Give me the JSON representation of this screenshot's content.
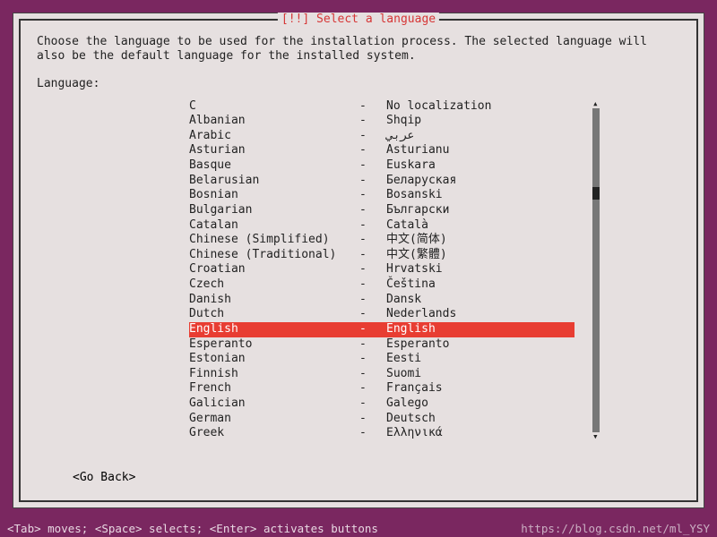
{
  "dialog": {
    "title": "[!!] Select a language",
    "instruction": "Choose the language to be used for the installation process. The selected language will also be the default language for the installed system.",
    "label": "Language:",
    "go_back": "<Go Back>"
  },
  "languages": [
    {
      "name": "C",
      "sep": "-",
      "native": "No localization",
      "selected": false
    },
    {
      "name": "Albanian",
      "sep": "-",
      "native": "Shqip",
      "selected": false
    },
    {
      "name": "Arabic",
      "sep": "-",
      "native": "عربي",
      "selected": false
    },
    {
      "name": "Asturian",
      "sep": "-",
      "native": "Asturianu",
      "selected": false
    },
    {
      "name": "Basque",
      "sep": "-",
      "native": "Euskara",
      "selected": false
    },
    {
      "name": "Belarusian",
      "sep": "-",
      "native": "Беларуская",
      "selected": false
    },
    {
      "name": "Bosnian",
      "sep": "-",
      "native": "Bosanski",
      "selected": false
    },
    {
      "name": "Bulgarian",
      "sep": "-",
      "native": "Български",
      "selected": false
    },
    {
      "name": "Catalan",
      "sep": "-",
      "native": "Català",
      "selected": false
    },
    {
      "name": "Chinese (Simplified)",
      "sep": "-",
      "native": "中文(简体)",
      "selected": false
    },
    {
      "name": "Chinese (Traditional)",
      "sep": "-",
      "native": "中文(繁體)",
      "selected": false
    },
    {
      "name": "Croatian",
      "sep": "-",
      "native": "Hrvatski",
      "selected": false
    },
    {
      "name": "Czech",
      "sep": "-",
      "native": "Čeština",
      "selected": false
    },
    {
      "name": "Danish",
      "sep": "-",
      "native": "Dansk",
      "selected": false
    },
    {
      "name": "Dutch",
      "sep": "-",
      "native": "Nederlands",
      "selected": false
    },
    {
      "name": "English",
      "sep": "-",
      "native": "English",
      "selected": true
    },
    {
      "name": "Esperanto",
      "sep": "-",
      "native": "Esperanto",
      "selected": false
    },
    {
      "name": "Estonian",
      "sep": "-",
      "native": "Eesti",
      "selected": false
    },
    {
      "name": "Finnish",
      "sep": "-",
      "native": "Suomi",
      "selected": false
    },
    {
      "name": "French",
      "sep": "-",
      "native": "Français",
      "selected": false
    },
    {
      "name": "Galician",
      "sep": "-",
      "native": "Galego",
      "selected": false
    },
    {
      "name": "German",
      "sep": "-",
      "native": "Deutsch",
      "selected": false
    },
    {
      "name": "Greek",
      "sep": "-",
      "native": "Ελληνικά",
      "selected": false
    }
  ],
  "footer": {
    "help": "<Tab> moves; <Space> selects; <Enter> activates buttons",
    "watermark": "https://blog.csdn.net/ml_YSY"
  },
  "colors": {
    "bg": "#7a2760",
    "panel": "#e6e0e0",
    "title": "#d63636",
    "highlight": "#e83d32"
  }
}
